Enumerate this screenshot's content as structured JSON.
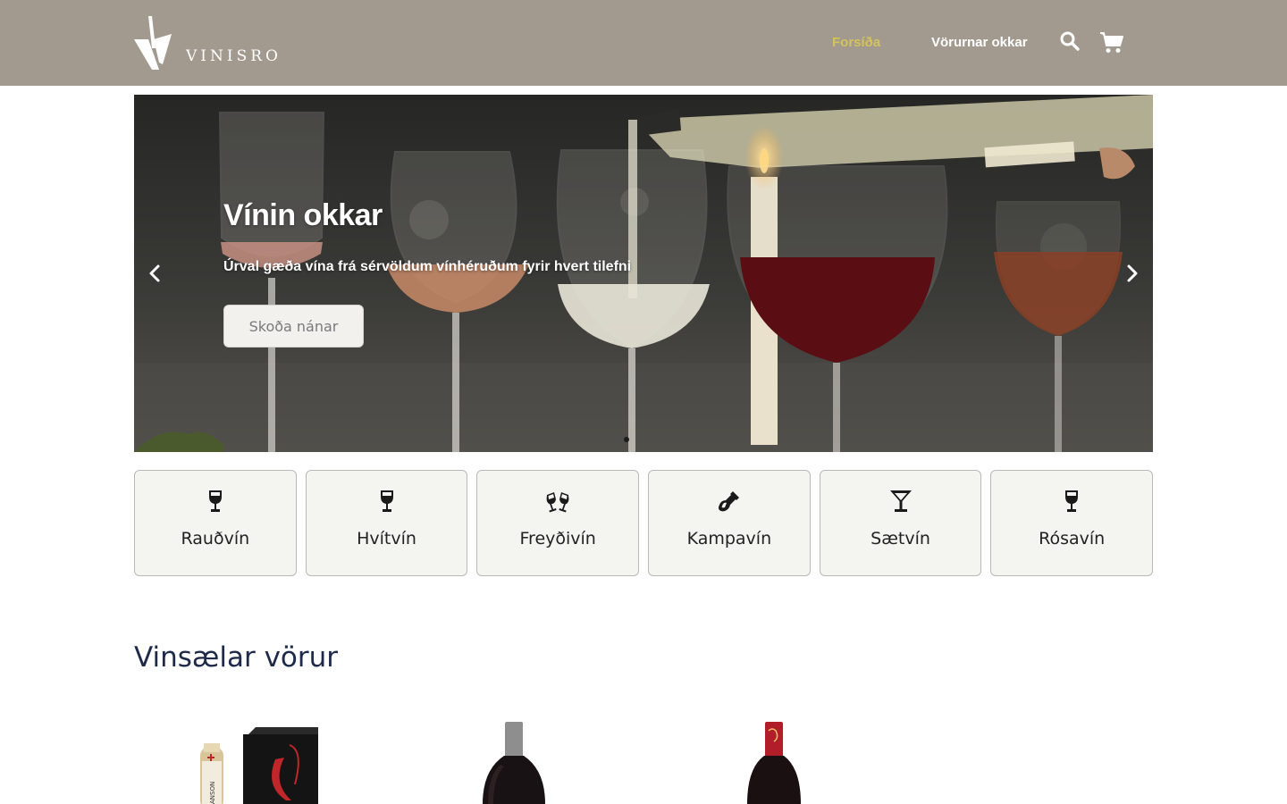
{
  "header": {
    "brand": "VINISRO",
    "nav": {
      "home": "Forsíða",
      "products": "Vörurnar okkar"
    },
    "icons": {
      "search": "search-icon",
      "cart": "cart-icon"
    },
    "colors": {
      "background": "#a39a8f",
      "active": "#d4c25a"
    }
  },
  "hero": {
    "title": "Vínin okkar",
    "subtitle": "Úrval gæða vína frá sérvöldum vínhéruðum fyrir hvert tilefni",
    "button": "Skoða nánar",
    "prev_icon": "chevron-left-icon",
    "next_icon": "chevron-right-icon"
  },
  "categories": [
    {
      "label": "Rauðvín",
      "icon": "wine-glass-icon"
    },
    {
      "label": "Hvítvín",
      "icon": "wine-glass-icon"
    },
    {
      "label": "Freyðivín",
      "icon": "glasses-cheers-icon"
    },
    {
      "label": "Kampavín",
      "icon": "champagne-bottle-icon"
    },
    {
      "label": "Sætvín",
      "icon": "martini-glass-icon"
    },
    {
      "label": "Rósavín",
      "icon": "wine-glass-icon"
    }
  ],
  "popular": {
    "title": "Vinsælar vörur"
  }
}
